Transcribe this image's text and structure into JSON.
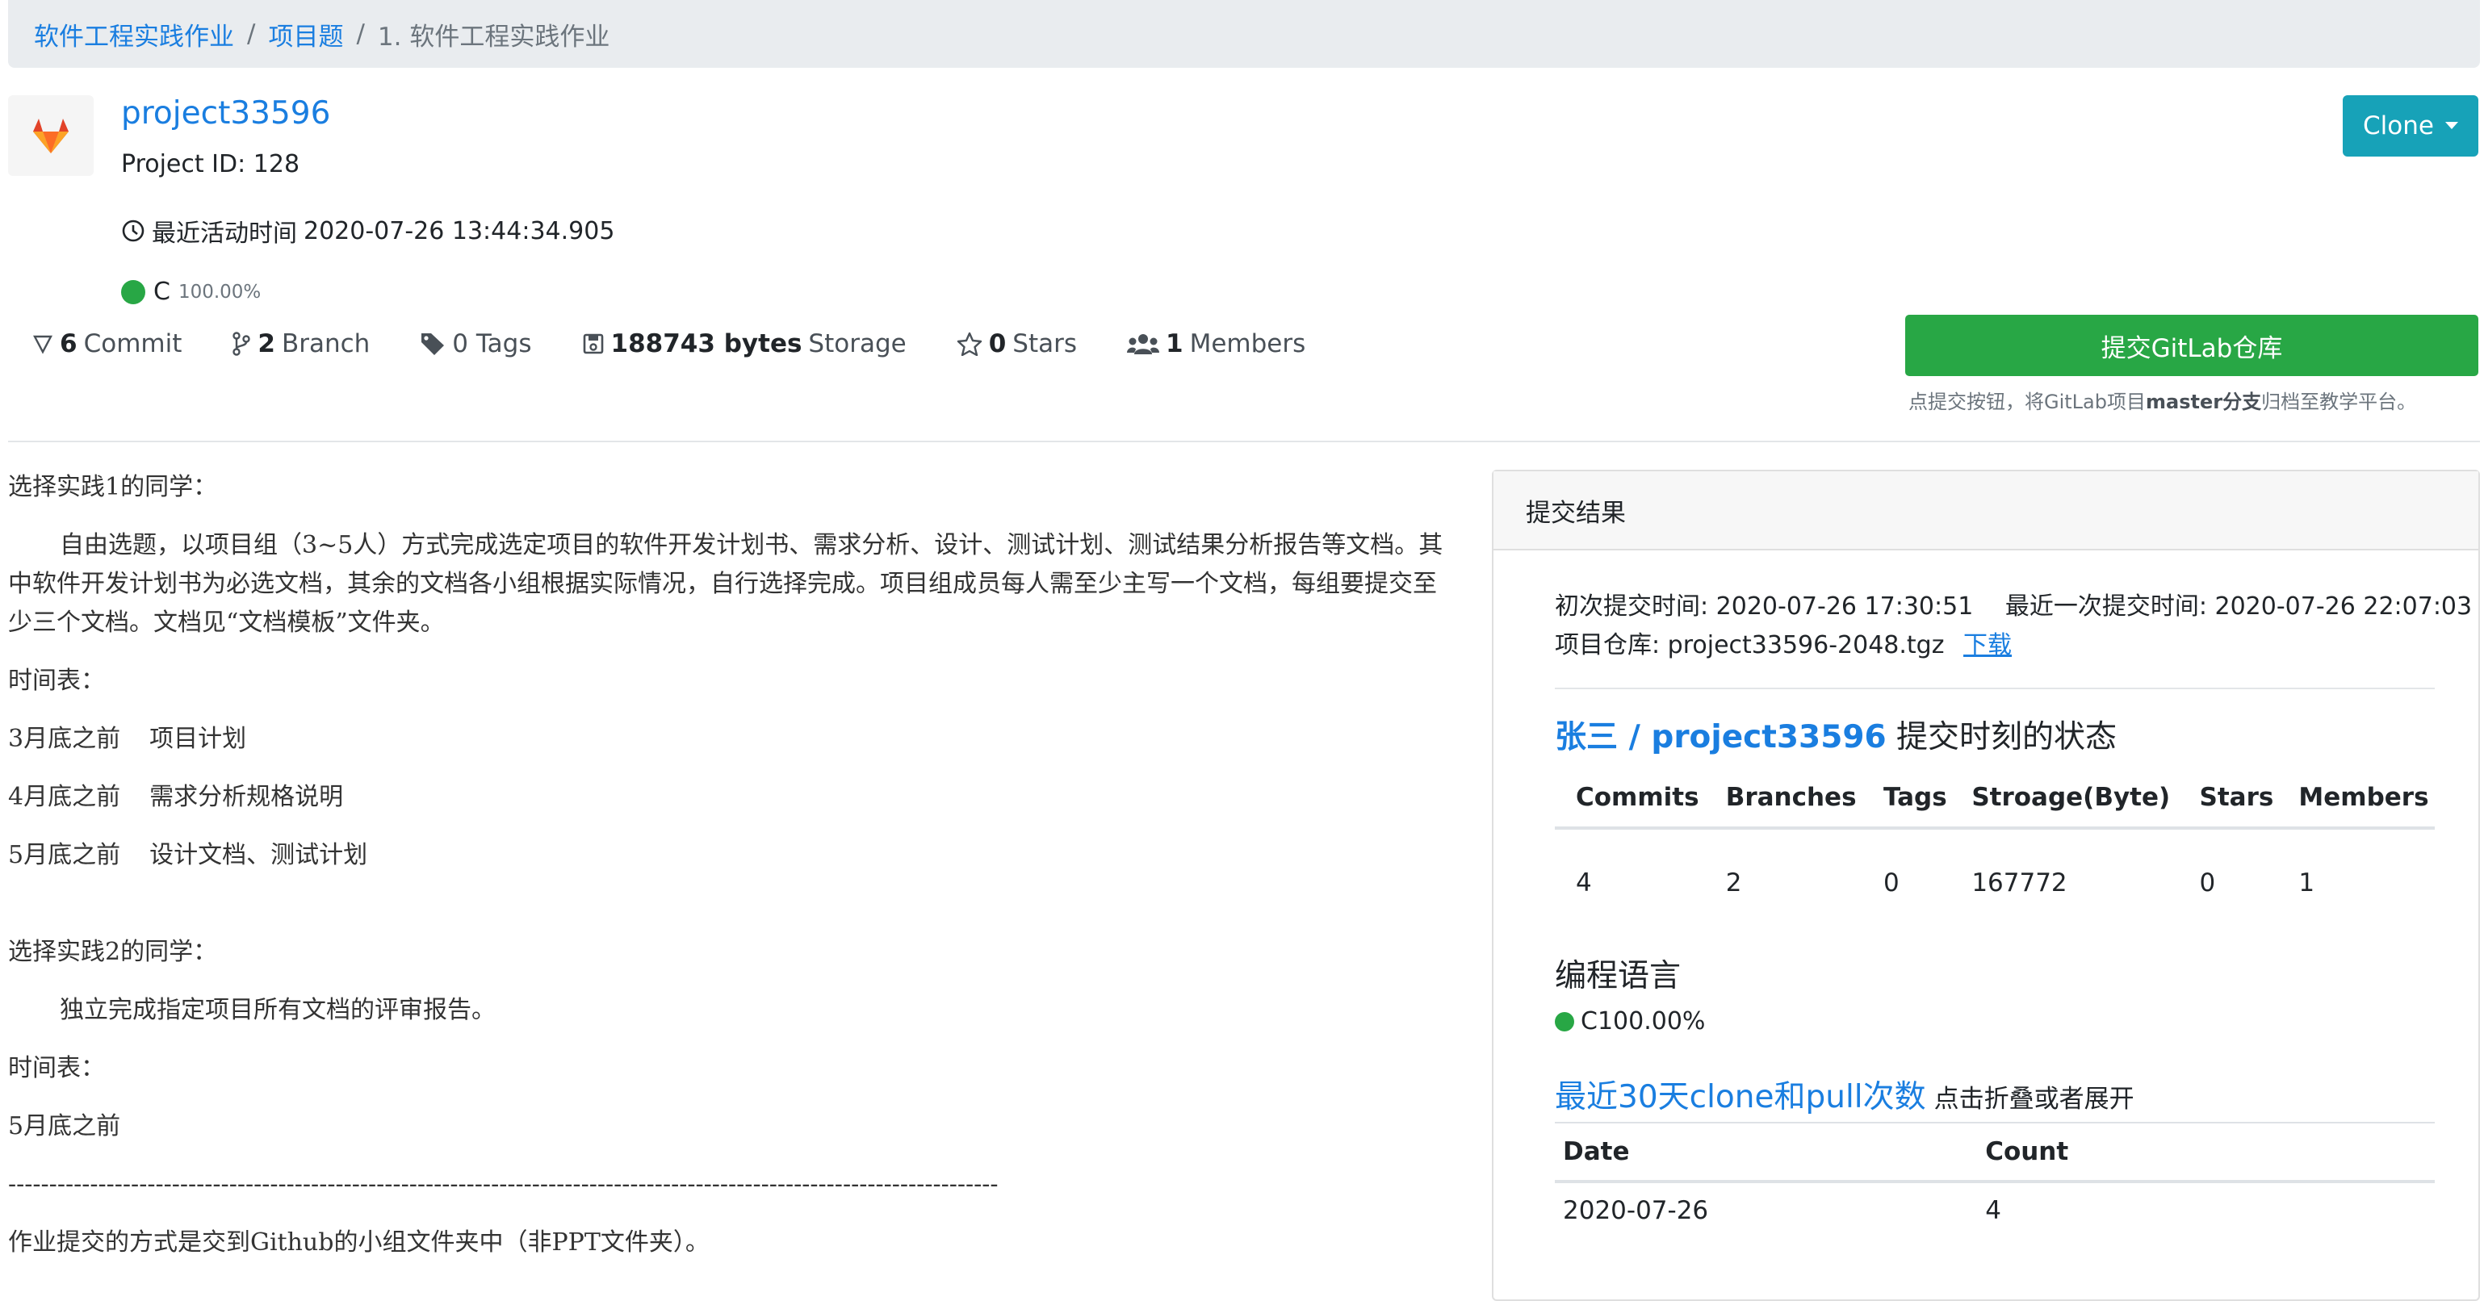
{
  "breadcrumb": {
    "course": "软件工程实践作业",
    "section": "项目题",
    "current": "1. 软件工程实践作业"
  },
  "project": {
    "name": "project33596",
    "id_text": "Project ID: 128",
    "activity_label": "最近活动时间",
    "activity_time": "2020-07-26 13:44:34.905",
    "language": "C",
    "language_pct": "100.00%",
    "language_color": "#28a745"
  },
  "stats": {
    "commits_num": "6",
    "commits_label": "Commit",
    "branches_num": "2",
    "branches_label": "Branch",
    "tags_text": "0 Tags",
    "storage_num": "188743 bytes",
    "storage_label": "Storage",
    "stars_num": "0",
    "stars_label": "Stars",
    "members_num": "1",
    "members_label": "Members"
  },
  "actions": {
    "clone_label": "Clone",
    "submit_label": "提交GitLab仓库",
    "hint_prefix": "点提交按钮，将GitLab项目",
    "hint_bold": "master分支",
    "hint_suffix": "归档至教学平台。"
  },
  "description": {
    "p1": "选择实践1的同学：",
    "p2": "自由选题，以项目组（3~5人）方式完成选定项目的软件开发计划书、需求分析、设计、测试计划、测试结果分析报告等文档。其中软件开发计划书为必选文档，其余的文档各小组根据实际情况，自行选择完成。项目组成员每人需至少主写一个文档，每组要提交至少三个文档。文档见“文档模板”文件夹。",
    "p3": "时间表：",
    "s1_when": "3月底之前",
    "s1_what": "项目计划",
    "s2_when": "4月底之前",
    "s2_what": "需求分析规格说明",
    "s3_when": "5月底之前",
    "s3_what": "设计文档、测试计划",
    "p4": "选择实践2的同学：",
    "p5": "独立完成指定项目所有文档的评审报告。",
    "p6": "时间表：",
    "p7": "5月底之前",
    "dashes": "-------------------------------------------------------------------------------------------------------------------------",
    "p8": "作业提交的方式是交到Github的小组文件夹中（非PPT文件夹）。"
  },
  "result": {
    "header": "提交结果",
    "first_label": "初次提交时间:",
    "first_time": "2020-07-26 17:30:51",
    "last_label": "最近一次提交时间:",
    "last_time": "2020-07-26 22:07:03",
    "repo_label": "项目仓库:",
    "repo_file": "project33596-2048.tgz",
    "download": "下载",
    "state_link": "张三 / project33596",
    "state_suffix": "提交时刻的状态",
    "table_headers": [
      "Commits",
      "Branches",
      "Tags",
      "Stroage(Byte)",
      "Stars",
      "Members"
    ],
    "table_values": [
      "4",
      "2",
      "0",
      "167772",
      "0",
      "1"
    ],
    "lang_title": "编程语言",
    "lang_value": "C100.00%",
    "clone_title": "最近30天clone和pull次数",
    "clone_hint": "点击折叠或者展开",
    "clone_headers": [
      "Date",
      "Count"
    ],
    "clone_rows": [
      [
        "2020-07-26",
        "4"
      ]
    ]
  }
}
